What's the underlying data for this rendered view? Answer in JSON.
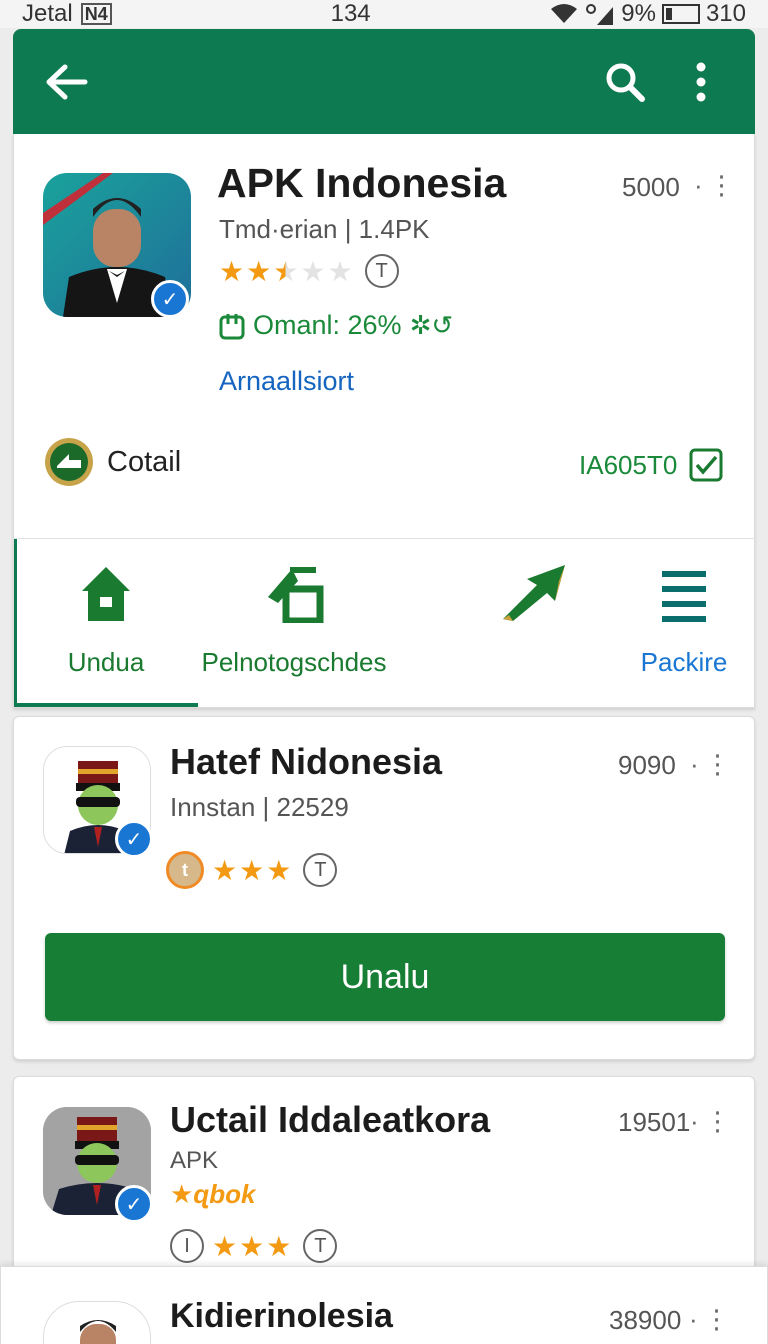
{
  "status_bar": {
    "carrier": "Jetal",
    "network": "N4",
    "time": "134",
    "battery": "9%",
    "extra": "310"
  },
  "app_bar": {
    "back_icon": "arrow-back-icon",
    "search_icon": "search-icon",
    "menu_icon": "more-vert-icon"
  },
  "colors": {
    "primary": "#0e7a52",
    "button": "#177e35",
    "star": "#f39a12",
    "link": "#1565c0",
    "verified": "#1976d2"
  },
  "featured": {
    "title": "APK Indonesia",
    "subtitle": "Tmd·erian | 1.4PK",
    "count": "5000",
    "rating": 2.5,
    "progress_text": "Omanl: 26%",
    "link": "Arnaallsiort",
    "badge_label": "Cotail",
    "code": "IA605T0"
  },
  "nav": [
    {
      "label": "Undua",
      "icon": "home-icon"
    },
    {
      "label": "Pelnotogschdes",
      "icon": "install-icon"
    },
    {
      "label": "",
      "icon": "trending-icon"
    },
    {
      "label": "Packire",
      "icon": "list-icon"
    }
  ],
  "apps": [
    {
      "title": "Hatef Nidonesia",
      "subtitle": "Innstan | 22529",
      "count": "9090",
      "rating": 3,
      "coin_glyph": "t",
      "button": "Unalu"
    },
    {
      "title": "Uctail  Iddaleatkora",
      "subtitle": "APK",
      "tag": "★ɋbok",
      "count": "19501",
      "rating": 3,
      "left_glyph": "I"
    },
    {
      "title": "Kidierinolesia",
      "count": "38900"
    }
  ]
}
